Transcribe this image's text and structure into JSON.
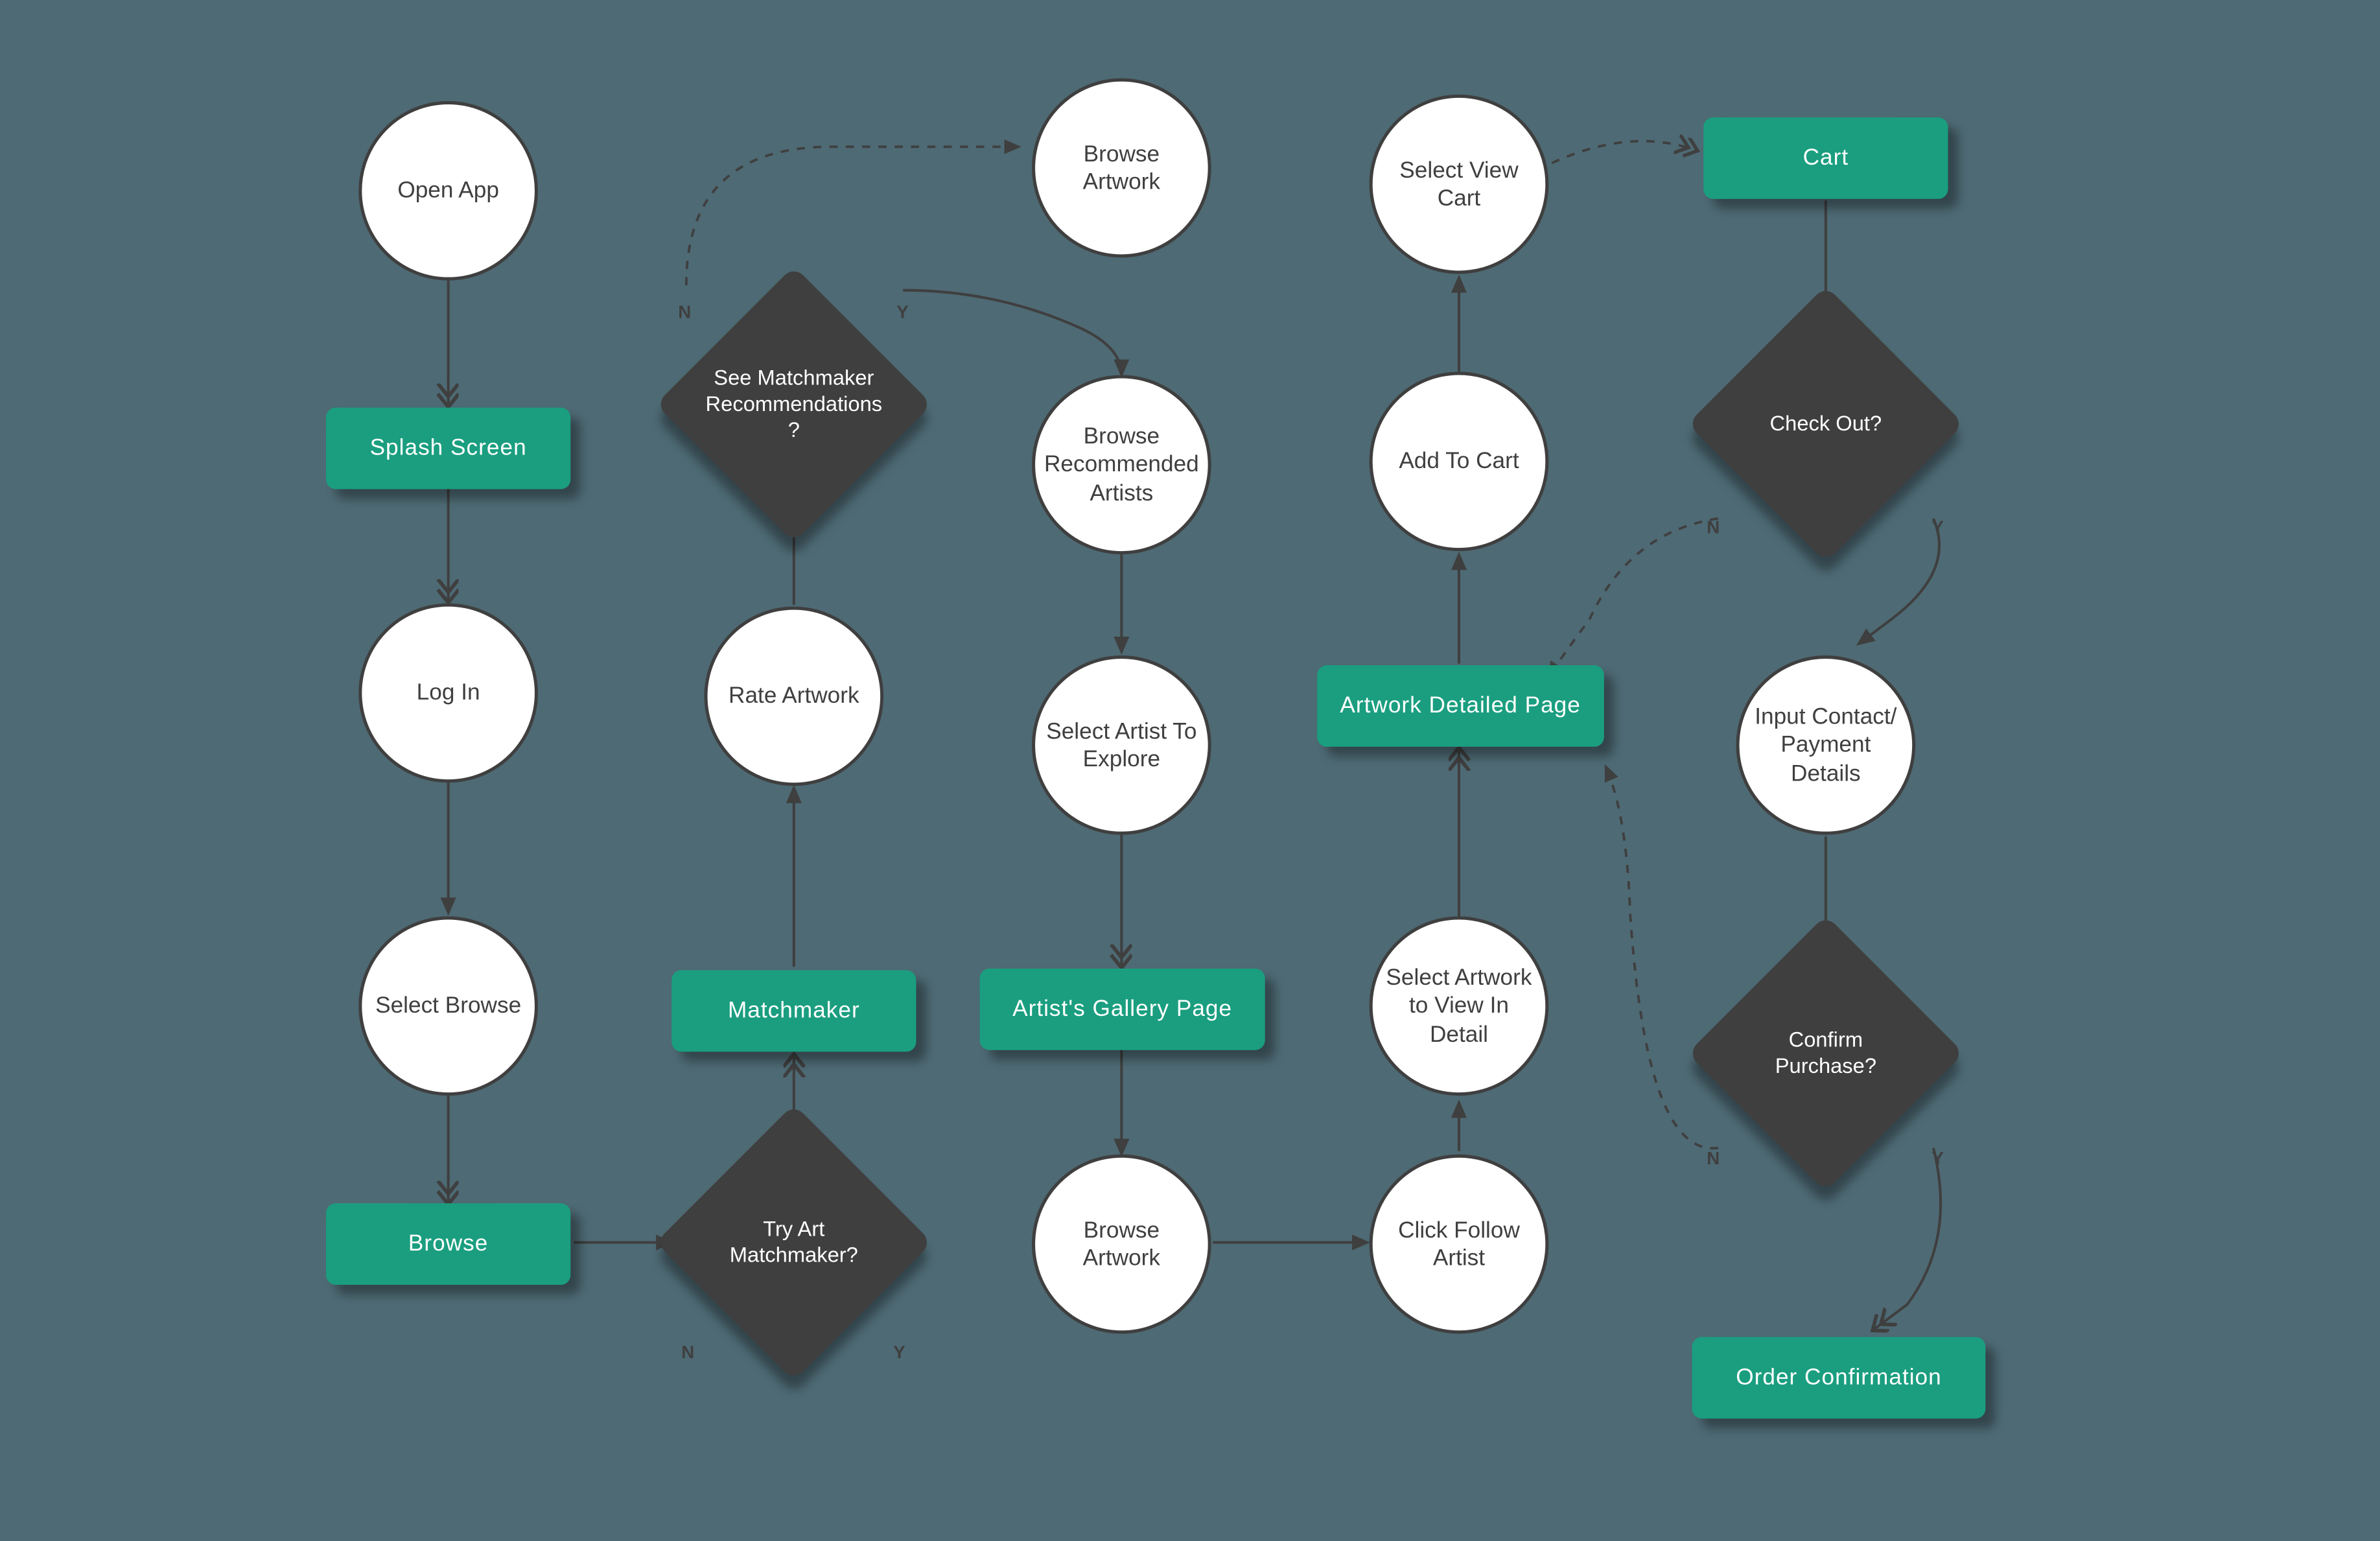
{
  "colors": {
    "bg": "#4e6a74",
    "circle": "#ffffff",
    "rect": "#1a9e7f",
    "diamond": "#3f3f3f",
    "circleText": "#3f3f3f",
    "rectText": "#ffffff"
  },
  "nodes": {
    "openApp": {
      "type": "circle",
      "label": "Open App"
    },
    "splash": {
      "type": "rect",
      "label": "Splash Screen"
    },
    "login": {
      "type": "circle",
      "label": "Log In"
    },
    "selectBrowse": {
      "type": "circle",
      "label": "Select Browse"
    },
    "browse": {
      "type": "rect",
      "label": "Browse"
    },
    "tryMatch": {
      "type": "diamond",
      "label": "Try Art Matchmaker?"
    },
    "matchmaker": {
      "type": "rect",
      "label": "Matchmaker"
    },
    "rateArtwork": {
      "type": "circle",
      "label": "Rate Artwork"
    },
    "seeRecs": {
      "type": "diamond",
      "label": "See Matchmaker Recommendations ?"
    },
    "browseArtworkTop": {
      "type": "circle",
      "label": "Browse Artwork"
    },
    "browseRecArtists": {
      "type": "circle",
      "label": "Browse Recommended Artists"
    },
    "selectArtist": {
      "type": "circle",
      "label": "Select Artist To Explore"
    },
    "artistGallery": {
      "type": "rect",
      "label": "Artist's Gallery Page"
    },
    "browseArtworkBot": {
      "type": "circle",
      "label": "Browse Artwork"
    },
    "clickFollow": {
      "type": "circle",
      "label": "Click Follow Artist"
    },
    "selectArtworkDetail": {
      "type": "circle",
      "label": "Select Artwork to View In Detail"
    },
    "artworkDetailed": {
      "type": "rect",
      "label": "Artwork Detailed Page"
    },
    "addToCart": {
      "type": "circle",
      "label": "Add To Cart"
    },
    "selectViewCart": {
      "type": "circle",
      "label": "Select View Cart"
    },
    "cart": {
      "type": "rect",
      "label": "Cart"
    },
    "checkOut": {
      "type": "diamond",
      "label": "Check Out?"
    },
    "inputDetails": {
      "type": "circle",
      "label": "Input Contact/ Payment Details"
    },
    "confirmPurchase": {
      "type": "diamond",
      "label": "Confirm Purchase?"
    },
    "orderConfirm": {
      "type": "rect",
      "label": "Order Confirmation"
    }
  },
  "labels": {
    "n1": "N",
    "y1": "Y",
    "n2": "N",
    "y2": "Y",
    "n3": "N",
    "y3": "Y",
    "n4": "N",
    "y4": "Y"
  }
}
